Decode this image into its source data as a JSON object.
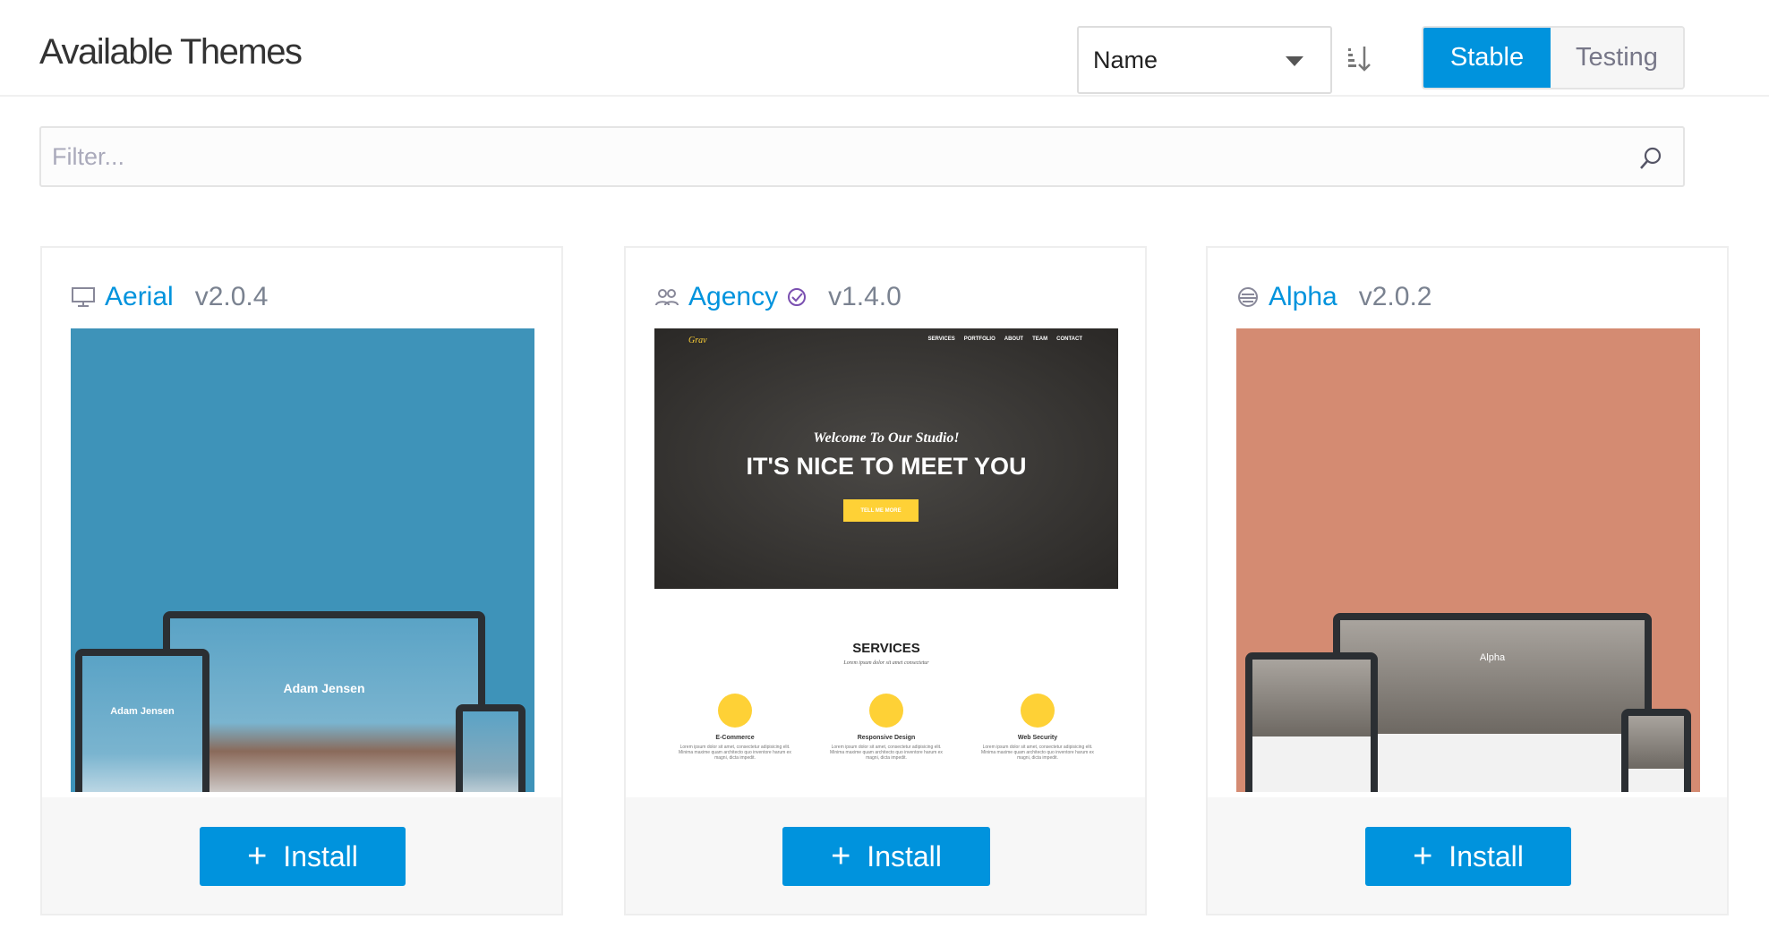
{
  "header": {
    "title": "Available Themes",
    "sort": {
      "selected": "Name"
    },
    "channel": {
      "options": [
        "Stable",
        "Testing"
      ],
      "active": "Stable"
    }
  },
  "filter": {
    "placeholder": "Filter..."
  },
  "colors": {
    "accent": "#0093dd",
    "aerial_bg": "#3e93b9",
    "alpha_bg": "#d48b72",
    "agency_yellow": "#fed136"
  },
  "themes": [
    {
      "name": "Aerial",
      "version": "v2.0.4",
      "icon": "desktop-icon",
      "install_label": "Install",
      "preview": {
        "name": "Adam Jensen",
        "name_small": "Adam Jensen"
      }
    },
    {
      "name": "Agency",
      "version": "v1.4.0",
      "icon": "users-icon",
      "verified": true,
      "install_label": "Install",
      "preview": {
        "logo": "Grav",
        "nav": [
          "SERVICES",
          "PORTFOLIO",
          "ABOUT",
          "TEAM",
          "CONTACT"
        ],
        "welcome": "Welcome To Our Studio!",
        "headline": "IT'S NICE TO MEET YOU",
        "cta": "TELL ME MORE",
        "services_title": "SERVICES",
        "services_sub": "Lorem ipsum dolor sit amet consectetur",
        "services": [
          {
            "title": "E-Commerce",
            "text": "Lorem ipsum dolor sit amet, consectetur adipisicing elit. Minima maxime quam architecto quo inventore harum ex magni, dicta impedit."
          },
          {
            "title": "Responsive Design",
            "text": "Lorem ipsum dolor sit amet, consectetur adipisicing elit. Minima maxime quam architecto quo inventore harum ex magni, dicta impedit."
          },
          {
            "title": "Web Security",
            "text": "Lorem ipsum dolor sit amet, consectetur adipisicing elit. Minima maxime quam architecto quo inventore harum ex magni, dicta impedit."
          }
        ]
      }
    },
    {
      "name": "Alpha",
      "version": "v2.0.2",
      "icon": "theme-icon",
      "install_label": "Install",
      "preview": {
        "name": "Alpha"
      }
    }
  ]
}
